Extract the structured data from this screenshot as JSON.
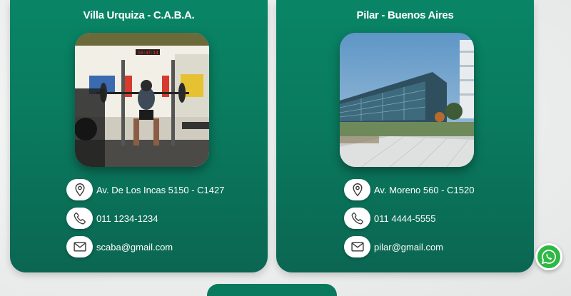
{
  "locations": [
    {
      "title": "Villa Urquiza - C.A.B.A.",
      "photo_alt": "gym",
      "address": "Av. De Los Incas 5150 - C1427",
      "phone": "011 1234-1234",
      "email": "scaba@gmail.com"
    },
    {
      "title": "Pilar - Buenos Aires",
      "photo_alt": "office building",
      "address": "Av. Moreno 560 - C1520",
      "phone": "011 4444-5555",
      "email": "pilar@gmail.com"
    }
  ],
  "icons": {
    "location": "map-pin-icon",
    "phone": "phone-icon",
    "email": "envelope-icon",
    "whatsapp": "whatsapp-icon"
  },
  "colors": {
    "card_green": "#0a7a5e",
    "whatsapp_green": "#2fb845",
    "text_white": "#ffffff"
  }
}
